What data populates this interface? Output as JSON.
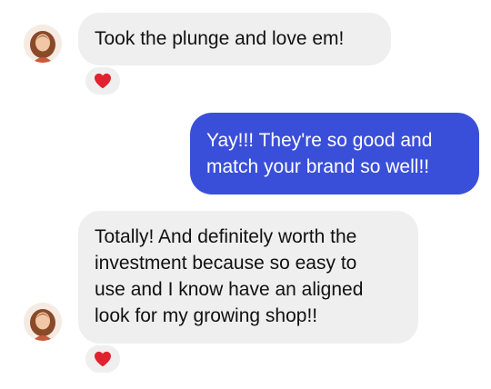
{
  "colors": {
    "incoming_bubble": "#efefef",
    "outgoing_bubble": "#3a4fd9",
    "heart": "#e0232e"
  },
  "messages": [
    {
      "direction": "incoming",
      "lines": [
        "Took the plunge and love em!"
      ],
      "reaction": "heart-icon"
    },
    {
      "direction": "outgoing",
      "lines": [
        "Yay!!! They're so good and",
        "match your brand so well!!"
      ]
    },
    {
      "direction": "incoming",
      "lines": [
        "Totally! And definitely worth the",
        "investment because so easy to",
        "use and I know have an aligned",
        "look for my growing shop!!"
      ],
      "reaction": "heart-icon"
    }
  ]
}
